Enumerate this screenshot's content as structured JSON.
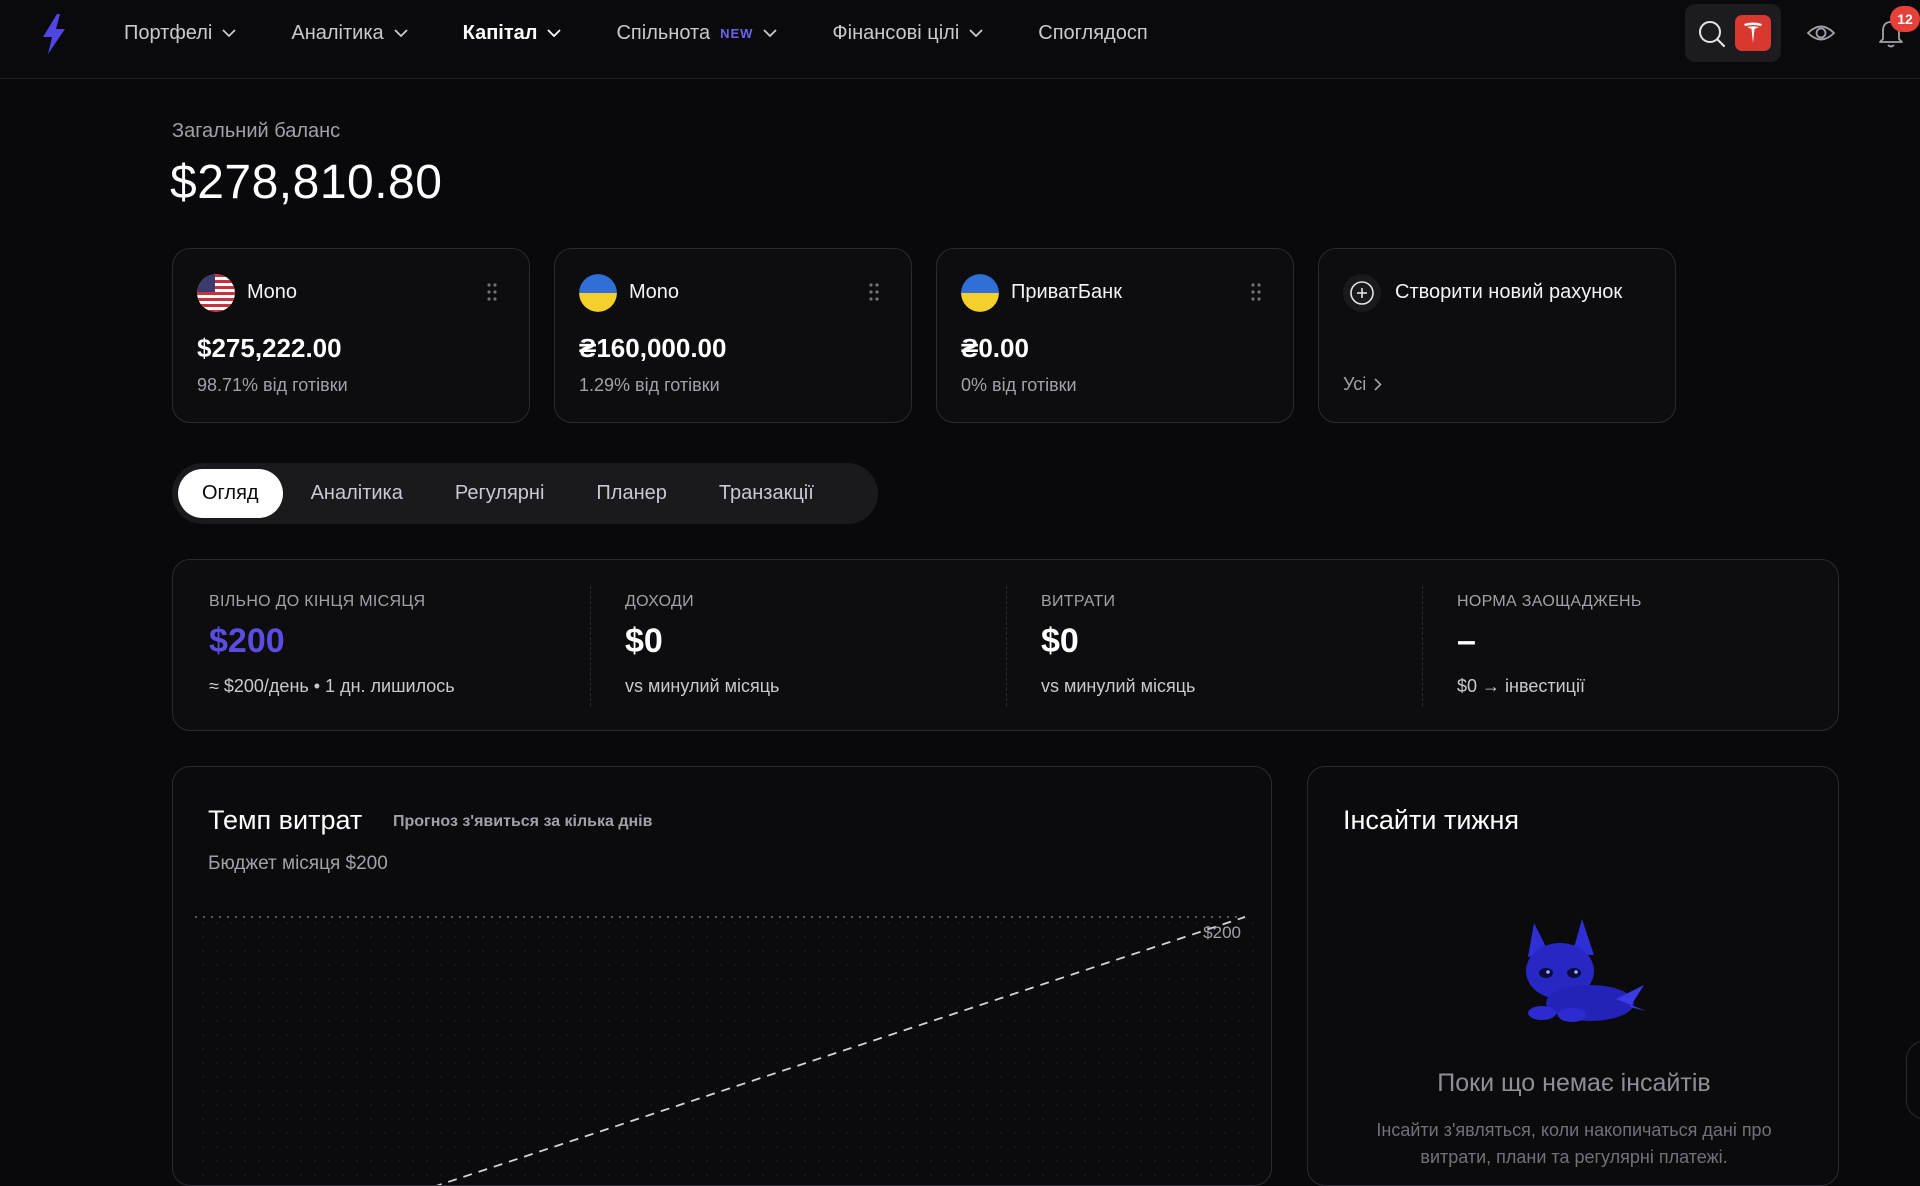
{
  "nav": {
    "items": [
      {
        "label": "Портфелі",
        "dropdown": true
      },
      {
        "label": "Аналітика",
        "dropdown": true
      },
      {
        "label": "Капітал",
        "dropdown": true,
        "active": true
      },
      {
        "label": "Спільнота",
        "badge": "NEW",
        "dropdown": true
      },
      {
        "label": "Фінансові цілі",
        "dropdown": true
      },
      {
        "label": "Споглядосп"
      }
    ],
    "notifications_count": "12"
  },
  "balance": {
    "label": "Загальний баланс",
    "value": "$278,810.80"
  },
  "accounts": [
    {
      "name": "Mono",
      "flag": "us-flag-icon",
      "amount": "$275,222.00",
      "share": "98.71% від готівки"
    },
    {
      "name": "Mono",
      "flag": "ua-flag-icon",
      "amount": "₴160,000.00",
      "share": "1.29% від готівки"
    },
    {
      "name": "ПриватБанк",
      "flag": "ua-flag-icon",
      "amount": "₴0.00",
      "share": "0% від готівки"
    }
  ],
  "create_card": {
    "label": "Створити новий рахунок",
    "all_link": "Усі"
  },
  "tabs": [
    {
      "label": "Огляд",
      "active": true
    },
    {
      "label": "Аналітика"
    },
    {
      "label": "Регулярні"
    },
    {
      "label": "Планер"
    },
    {
      "label": "Транзакції"
    }
  ],
  "stats": [
    {
      "label": "ВІЛЬНО ДО КІНЦЯ МІСЯЦЯ",
      "value": "$200",
      "sub": "≈ $200/день • 1 дн. лишилось",
      "accent": true
    },
    {
      "label": "ДОХОДИ",
      "value": "$0",
      "sub": "vs минулий місяць"
    },
    {
      "label": "ВИТРАТИ",
      "value": "$0",
      "sub": "vs минулий місяць"
    },
    {
      "label": "НОРМА ЗАОЩАДЖЕНЬ",
      "value": "–",
      "sub": "$0 → інвестиції"
    }
  ],
  "pace": {
    "title": "Темп витрат",
    "hint": "Прогноз з'явиться за кілька днів",
    "budget": "Бюджет місяця $200",
    "budget_line_label": "$200"
  },
  "insights": {
    "title": "Інсайти тижня",
    "empty_title": "Поки що немає інсайтів",
    "empty_desc": "Інсайти з'являться, коли накопичаться дані про витрати, плани та регулярні платежі."
  },
  "colors": {
    "accent": "#5b4de0",
    "background": "#09090b",
    "card_border": "#2a2a30",
    "badge_red": "#e5413a",
    "tesla_red": "#d8382f"
  }
}
